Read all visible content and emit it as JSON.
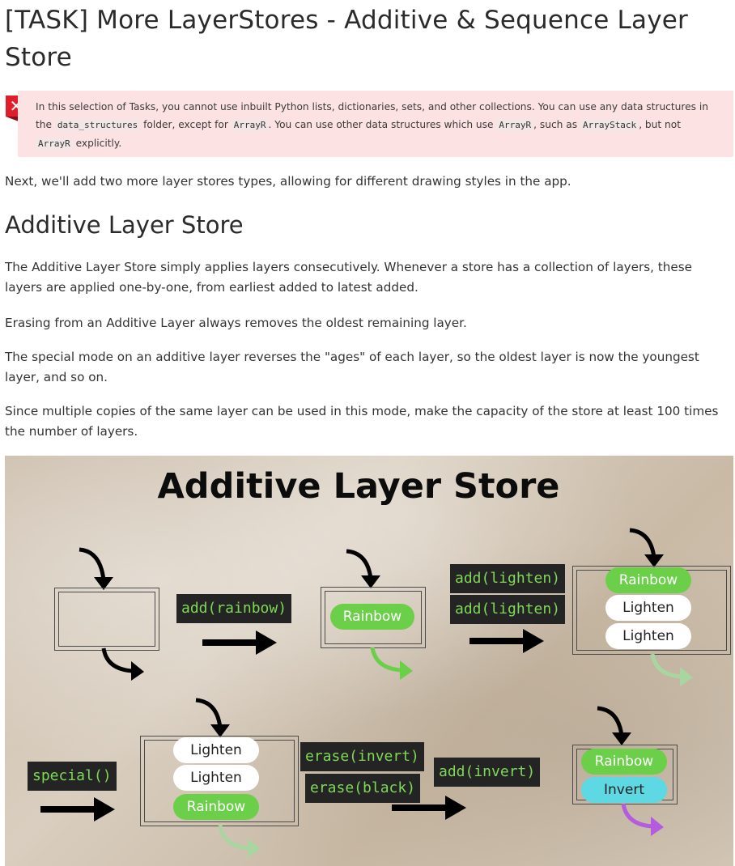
{
  "page": {
    "title": "[TASK] More LayerStores - Additive & Sequence Layer Store"
  },
  "alert": {
    "icon": "close-icon",
    "text_1": "In this selection of Tasks, you cannot use inbuilt Python lists, dictionaries, sets, and other collections. You can use any data structures in the ",
    "code_1": "data_structures",
    "text_2": " folder, except for ",
    "code_2": "ArrayR",
    "text_3": ". You can use other data structures which use ",
    "code_3": "ArrayR",
    "text_4": ", such as ",
    "code_4": "ArrayStack",
    "text_5": ", but not ",
    "code_5": "ArrayR",
    "text_6": " explicitly."
  },
  "intro": "Next, we'll add two more layer stores types, allowing for different drawing styles in the app.",
  "section": {
    "heading": "Additive Layer Store",
    "paragraphs": [
      "The Additive Layer Store simply applies layers consecutively. Whenever a store has a collection of layers, these layers are applied one-by-one, from earliest added to latest added.",
      "Erasing from an Additive Layer always removes the oldest remaining layer.",
      "The special mode on an additive layer reverses the \"ages\" of each layer, so the oldest layer is now the youngest layer, and so on.",
      "Since multiple copies of the same layer can be used in this mode, make the capacity of the store at least 100 times the number of layers."
    ]
  },
  "figure": {
    "title": "Additive Layer Store",
    "ops": {
      "add_rainbow": "add(rainbow)",
      "add_lighten": "add(lighten)",
      "special": "special()",
      "erase_invert": "erase(invert)",
      "erase_black": "erase(black)",
      "add_invert": "add(invert)"
    },
    "layers": {
      "rainbow": "Rainbow",
      "lighten": "Lighten",
      "invert": "Invert"
    },
    "colors": {
      "code_bg": "#242424",
      "code_text": "#7ed957",
      "rainbow": "#6ccf4a",
      "invert": "#5ed8e3",
      "out_arrow_green": "#6ccf4a",
      "out_arrow_pale": "#a9d6a0",
      "out_arrow_purple": "#b45be0"
    }
  }
}
